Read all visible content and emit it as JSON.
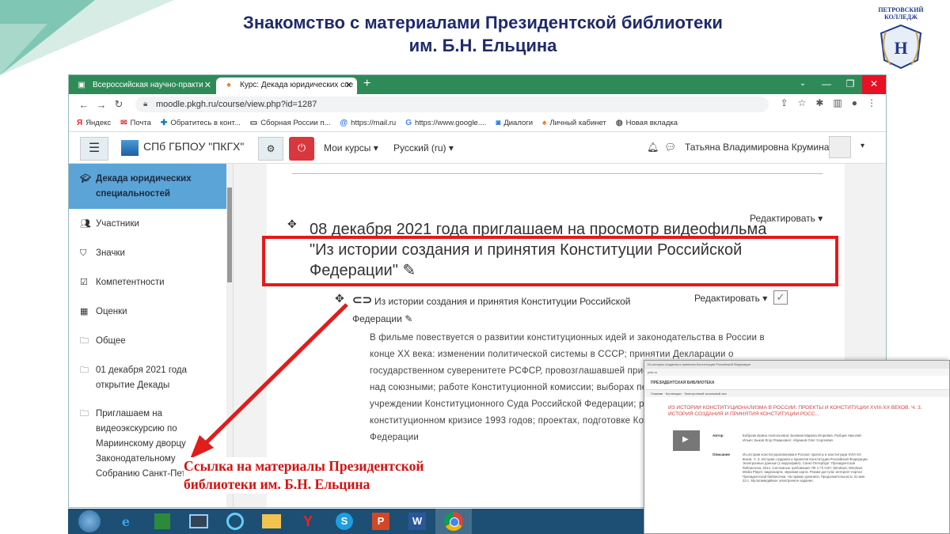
{
  "slide": {
    "title_line1": "Знакомство с материалами Президентской библиотеки",
    "title_line2": "им. Б.Н. Ельцина",
    "logo_top": "ПЕТРОВСКИЙ",
    "logo_bottom": "КОЛЛЕДЖ",
    "annotation_line1": "Ссылка на материалы Президентской",
    "annotation_line2": "библиотеки им. Б.Н. Ельцина",
    "accent_red": "#e21b1b"
  },
  "browser": {
    "tabs": [
      {
        "label": "Всероссийская научно-практи",
        "icon": "site-favicon"
      },
      {
        "label": "Курс: Декада юридических спе",
        "icon": "moodle-favicon"
      }
    ],
    "url": "moodle.pkgh.ru/course/view.php?id=1287",
    "bookmarks": [
      {
        "label": "Яндекс",
        "icon": "yandex-icon"
      },
      {
        "label": "Почта",
        "icon": "mail-icon"
      },
      {
        "label": "Обратитесь в конт...",
        "icon": "support-icon"
      },
      {
        "label": "Сборная России п...",
        "icon": "video-icon"
      },
      {
        "label": "https://mail.ru",
        "icon": "mailru-icon"
      },
      {
        "label": "https://www.google....",
        "icon": "google-icon"
      },
      {
        "label": "Диалоги",
        "icon": "chat-icon"
      },
      {
        "label": "Личный кабинет",
        "icon": "moodle-favicon"
      },
      {
        "label": "Новая вкладка",
        "icon": "globe-icon"
      }
    ]
  },
  "moodle": {
    "site_name": "СПб ГБПОУ \"ПКГХ\"",
    "my_courses": "Мои курсы",
    "language": "Русский (ru)",
    "user_name": "Татьяна Владимировна Крумина",
    "sidebar": [
      {
        "label": "Декада юридических специальностей",
        "icon": "graduation-cap-icon",
        "active": true
      },
      {
        "label": "Участники",
        "icon": "users-icon"
      },
      {
        "label": "Значки",
        "icon": "shield-icon"
      },
      {
        "label": "Компетентности",
        "icon": "checkbox-icon"
      },
      {
        "label": "Оценки",
        "icon": "table-icon"
      },
      {
        "label": "Общее",
        "icon": "folder-icon"
      },
      {
        "label": "01 декабря 2021 года открытие Декады",
        "icon": "folder-icon"
      },
      {
        "label": "Приглашаем на видеоэкскурсию по Мариинскому дворцу Законодательному Собранию Санкт-Петербурга",
        "icon": "folder-icon"
      }
    ],
    "section": {
      "title": "08 декабря 2021 года приглашаем на просмотр видеофильма \"Из истории создания и принятия Конституции Российской Федерации\"",
      "edit_label": "Редактировать"
    },
    "activity": {
      "name": "Из истории создания и принятия Конституции Российской Федерации",
      "edit_label": "Редактировать",
      "description": "В фильме повествуется о развитии конституционных идей и законодательства в России в конце XX века: изменении политической системы в СССР; принятии Декларации о государственном суверенитете РСФСР, провозглашавшей приоритет российских законов над союзными; работе Конституционной комиссии; выборах первого Президента России; учреждении Конституционного Суда Российской Федерации; распаде СССР; конституционном кризисе 1993 годов; проектах, подготовке Конституции Российской Федерации"
    }
  },
  "inset": {
    "tab_text": "Из истории создания и принятия Конституции Российской Федерации",
    "logo_text": "ПРЕЗИДЕНТСКАЯ БИБЛИОТЕКА",
    "title": "ИЗ ИСТОРИИ КОНСТИТУЦИОНАЛИЗМА В РОССИИ: ПРОЕКТЫ И КОНСТИТУЦИИ XVIII-XX ВЕКОВ. Ч. 3. ИСТОРИЯ СОЗДАНИЯ И ПРИНЯТИЯ КОНСТИТУЦИИ РОСС...",
    "label_author": "Автор",
    "label_description": "Описание"
  }
}
